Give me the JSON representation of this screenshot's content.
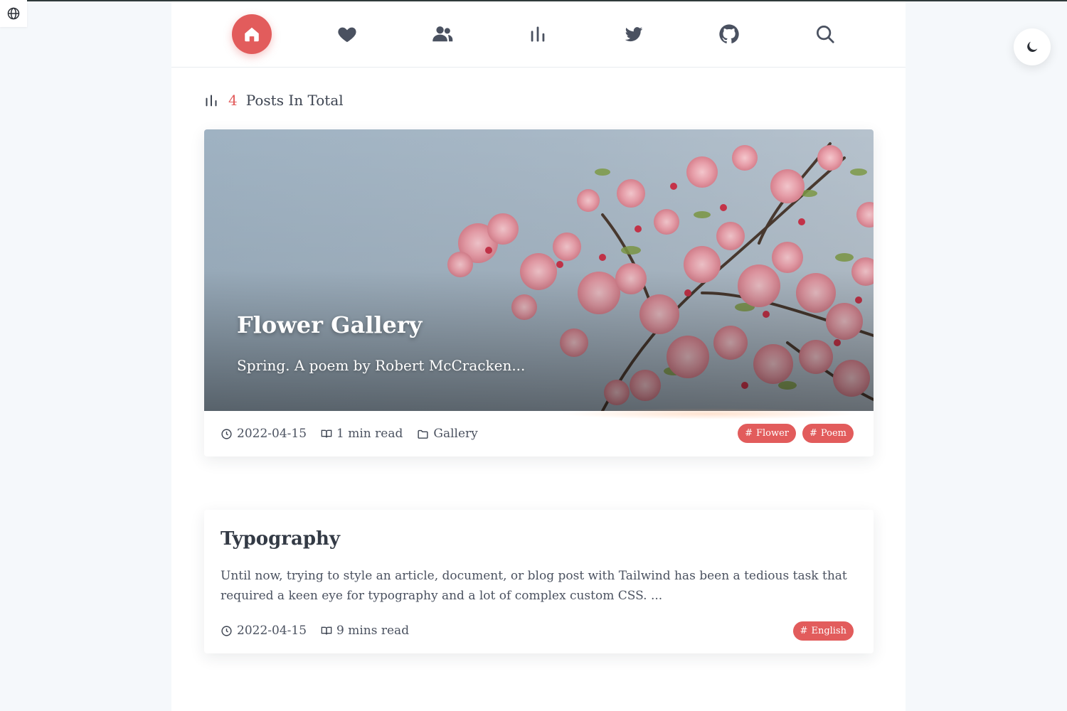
{
  "nav": {
    "items": [
      {
        "icon": "home-icon",
        "active": true
      },
      {
        "icon": "heart-icon",
        "active": false
      },
      {
        "icon": "users-icon",
        "active": false
      },
      {
        "icon": "stats-icon",
        "active": false
      },
      {
        "icon": "twitter-icon",
        "active": false
      },
      {
        "icon": "github-icon",
        "active": false
      },
      {
        "icon": "search-icon",
        "active": false
      }
    ]
  },
  "controls": {
    "language_icon": "globe-icon",
    "theme_icon": "moon-icon"
  },
  "summary": {
    "count": "4",
    "label": "Posts In Total"
  },
  "posts": [
    {
      "title": "Flower Gallery",
      "excerpt": "Spring. A poem by Robert McCracken...",
      "date": "2022-04-15",
      "read_time": "1 min read",
      "category": "Gallery",
      "tags": [
        "Flower",
        "Poem"
      ]
    },
    {
      "title": "Typography",
      "excerpt": "Until now, trying to style an article, document, or blog post with Tailwind has been a tedious task that required a keen eye for typography and a lot of complex custom CSS. ...",
      "date": "2022-04-15",
      "read_time": "9 mins read",
      "tags": [
        "English"
      ]
    }
  ],
  "colors": {
    "accent": "#e25c5c",
    "text": "#3d4451",
    "page_bg": "#f5f8fb"
  }
}
